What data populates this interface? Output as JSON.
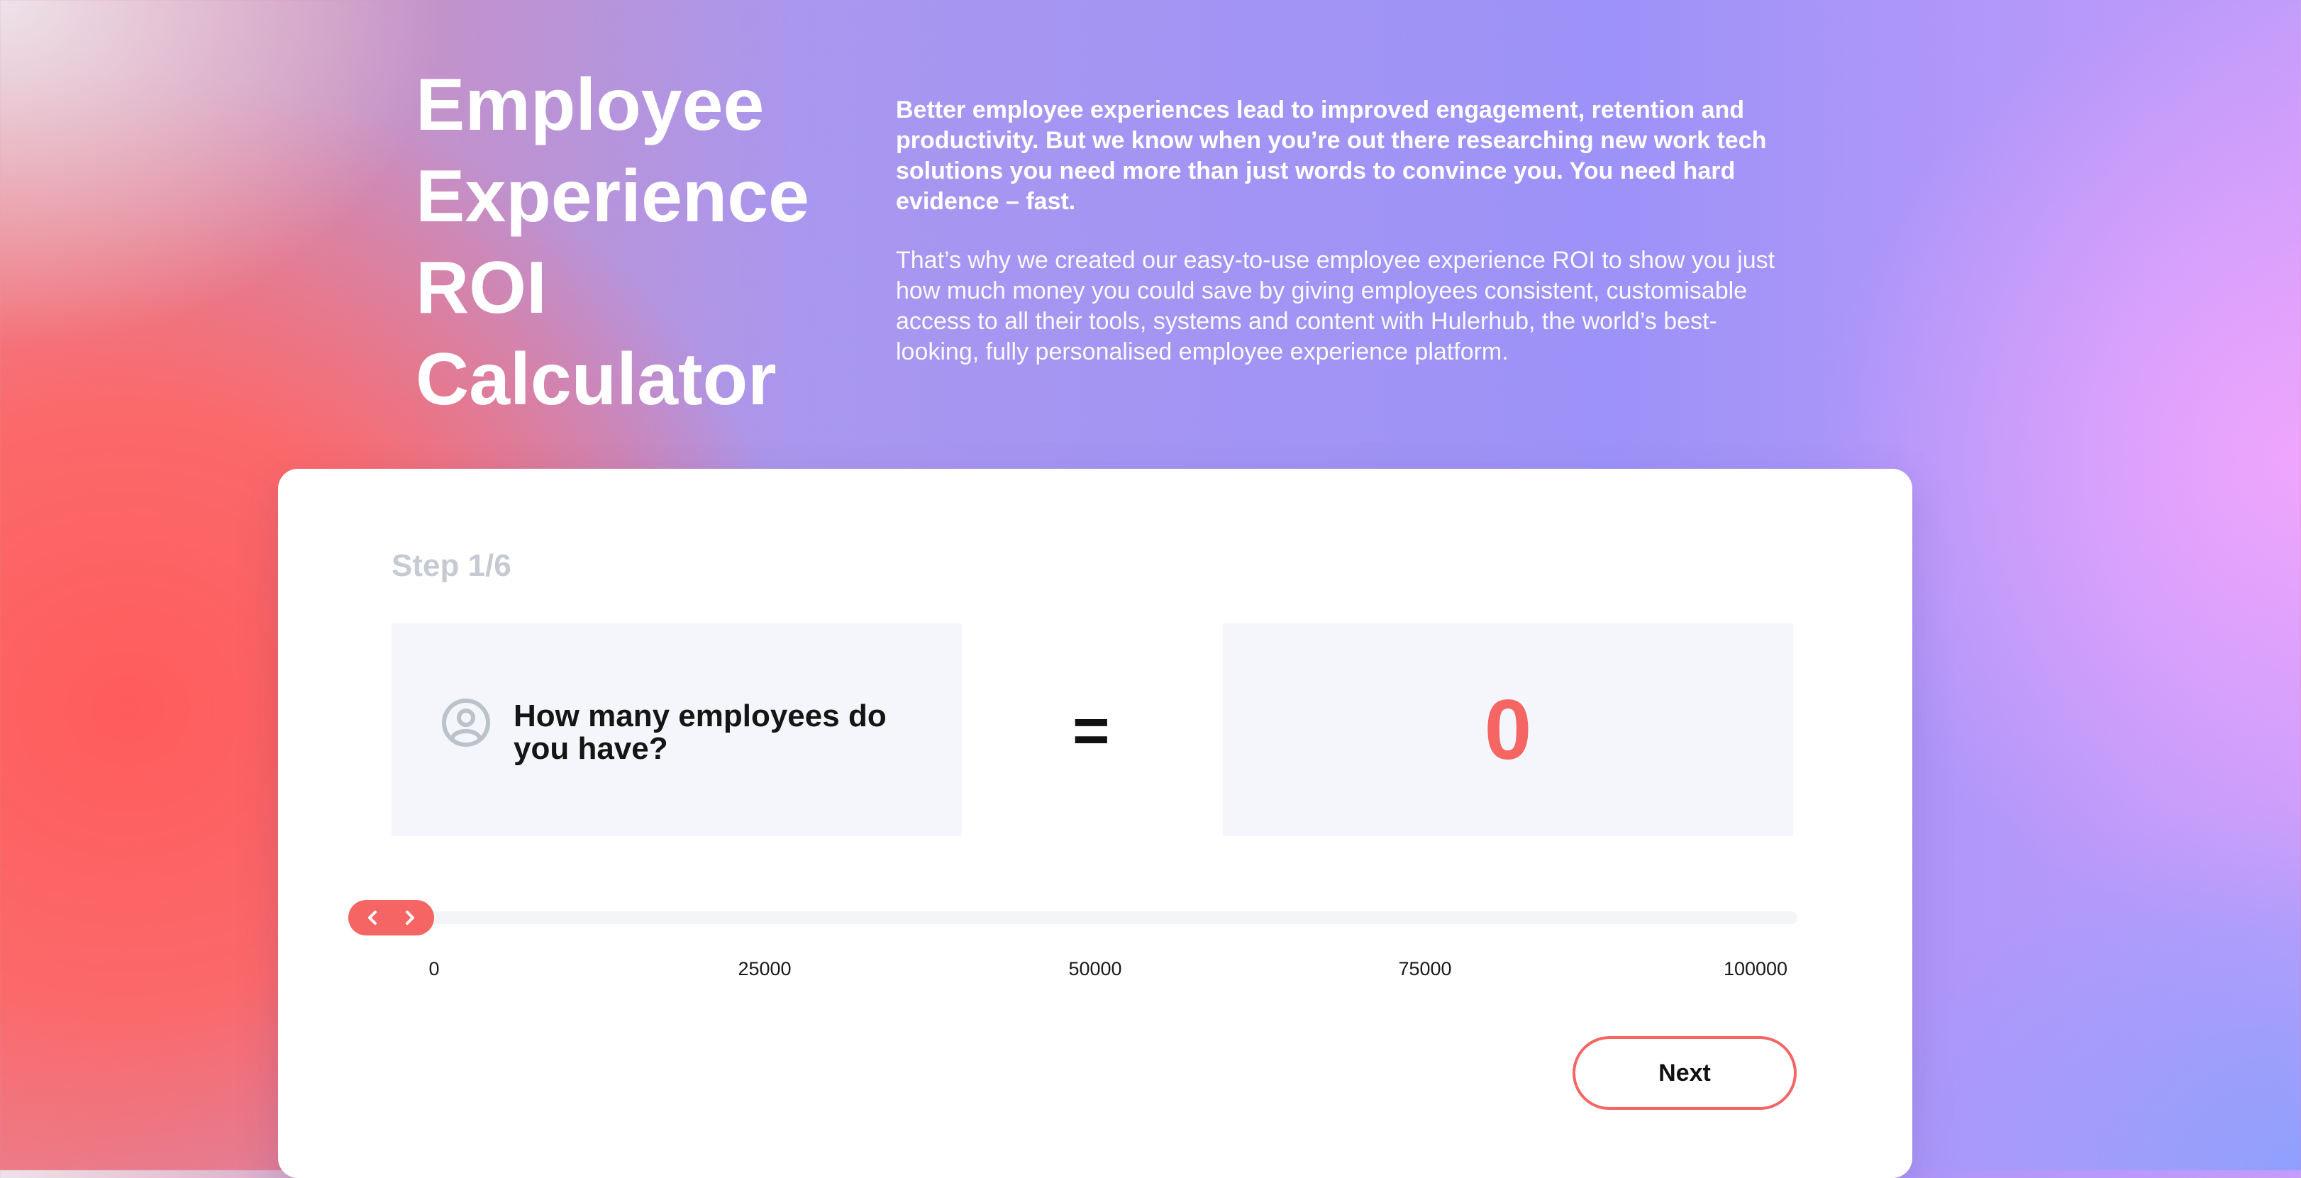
{
  "hero": {
    "title_lines": [
      "Employee",
      "Experience",
      "ROI",
      "Calculator"
    ]
  },
  "intro": {
    "lead": "Better employee experiences lead to improved engagement, retention and productivity. But we know when you’re out there researching new work tech solutions you need more than just words to convince you. You need hard evidence – fast.",
    "body": "That’s why we created our easy-to-use employee experience ROI to show you just how much money you could save by giving employees consistent, customisable access to all their tools, systems and content with Hulerhub, the world’s best-looking, fully personalised employee experience platform."
  },
  "calculator": {
    "step_label": "Step 1/6",
    "question": "How many employees do you have?",
    "question_icon": "user-circle-icon",
    "equals": "=",
    "result_value": "0",
    "slider": {
      "value": 0,
      "min": 0,
      "max": 100000,
      "ticks": [
        "0",
        "25000",
        "50000",
        "75000",
        "100000"
      ],
      "handle_icons": [
        "chevron-left-icon",
        "chevron-right-icon"
      ]
    },
    "next_label": "Next"
  },
  "colors": {
    "accent": "#f56564",
    "panel_bg": "#f4f6fb",
    "step_label": "#c5cad3",
    "icon_gray": "#bcc2cc"
  }
}
